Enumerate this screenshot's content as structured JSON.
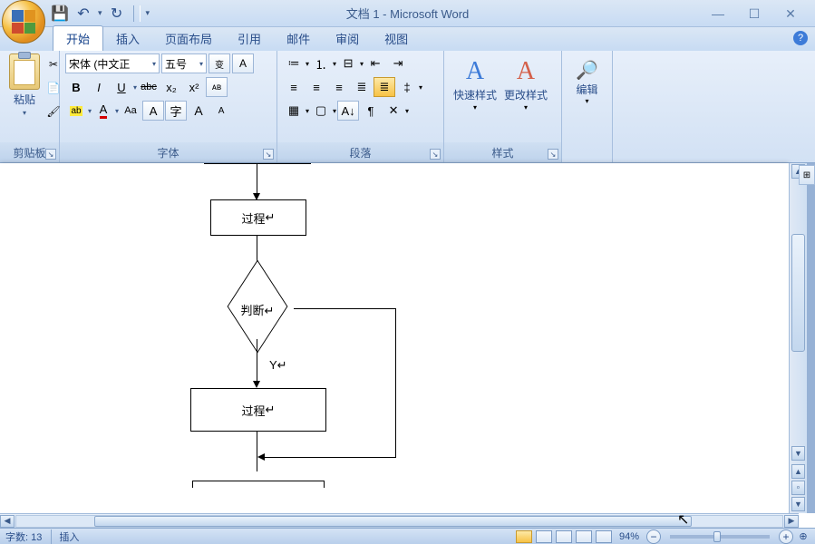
{
  "titlebar": {
    "title": "文档 1 - Microsoft Word"
  },
  "qat": {
    "save": "💾",
    "undo": "↶",
    "redo": "↻"
  },
  "tabs": {
    "home": "开始",
    "insert": "插入",
    "layout": "页面布局",
    "references": "引用",
    "mailings": "邮件",
    "review": "审阅",
    "view": "视图"
  },
  "clipboard": {
    "paste": "粘贴",
    "label": "剪贴板",
    "cut": "✂",
    "copy": "📄",
    "painter": "🖌"
  },
  "font": {
    "label": "字体",
    "name": "宋体 (中文正",
    "size": "五号",
    "bold": "B",
    "italic": "I",
    "underline": "U",
    "strike": "abc",
    "sub": "x₂",
    "sup": "x²",
    "clear": "Aa",
    "highlight": "ab",
    "color": "A",
    "case": "Aa",
    "charbg": "A",
    "charborder": "字",
    "phonetic": "A",
    "grow": "A",
    "shrink": "A",
    "wen": "变",
    "a_box": "A"
  },
  "paragraph": {
    "label": "段落"
  },
  "styles": {
    "label": "样式",
    "quick": "快速样式",
    "change": "更改样式"
  },
  "editing": {
    "label": "编辑",
    "find": "🔍"
  },
  "flowchart": {
    "process1": "过程",
    "decision": "判断",
    "branch_y": "Y",
    "process2": "过程"
  },
  "status": {
    "words": "字数: 13",
    "mode": "插入",
    "zoom": "94%"
  }
}
